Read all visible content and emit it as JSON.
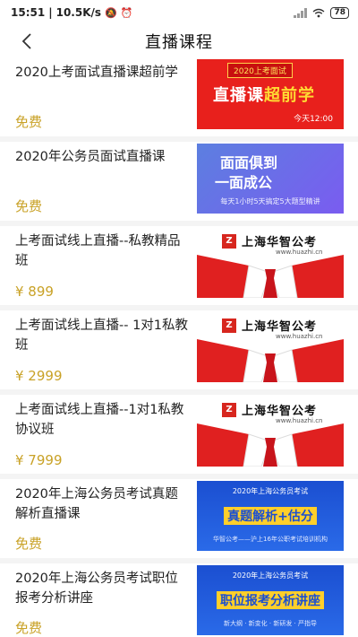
{
  "status_bar": {
    "time": "15:51",
    "network_speed": "10.5K/s",
    "battery": "78"
  },
  "header": {
    "title": "直播课程",
    "back_icon": "chevron-left-icon"
  },
  "colors": {
    "price_gold": "#c9a227",
    "accent_red": "#e8201c",
    "background": "#f4f4f4"
  },
  "courses": [
    {
      "title": "2020上考面试直播课超前学",
      "price": "免费",
      "thumb": {
        "tag": "2020上考面试",
        "main": "直播课",
        "highlight": "超前学",
        "time": "今天12:00"
      }
    },
    {
      "title": "2020年公务员面试直播课",
      "price": "免费",
      "thumb": {
        "line1": "面面俱到",
        "line2": "一面成公",
        "note": "每天1小时5天搞定5大题型精讲"
      }
    },
    {
      "title": "上考面试线上直播--私教精品班",
      "price": "¥ 899",
      "thumb": {
        "brand": "上海华智公考",
        "url": "www.huazhi.cn"
      }
    },
    {
      "title": "上考面试线上直播-- 1对1私教班",
      "price": "¥ 2999",
      "thumb": {
        "brand": "上海华智公考",
        "url": "www.huazhi.cn"
      }
    },
    {
      "title": "上考面试线上直播--1对1私教协议班",
      "price": "¥ 7999",
      "thumb": {
        "brand": "上海华智公考",
        "url": "www.huazhi.cn"
      }
    },
    {
      "title": "2020年上海公务员考试真题解析直播课",
      "price": "免费",
      "thumb": {
        "head": "2020年上海公务员考试",
        "main": "真题解析+估分",
        "foot": "华智公考——沪上16年公职考试培训机构"
      }
    },
    {
      "title": "2020年上海公务员考试职位报考分析讲座",
      "price": "免费",
      "thumb": {
        "head": "2020年上海公务员考试",
        "main": "职位报考分析讲座",
        "foot": "新大纲 · 新变化 · 新研发 · 严指导"
      }
    }
  ]
}
